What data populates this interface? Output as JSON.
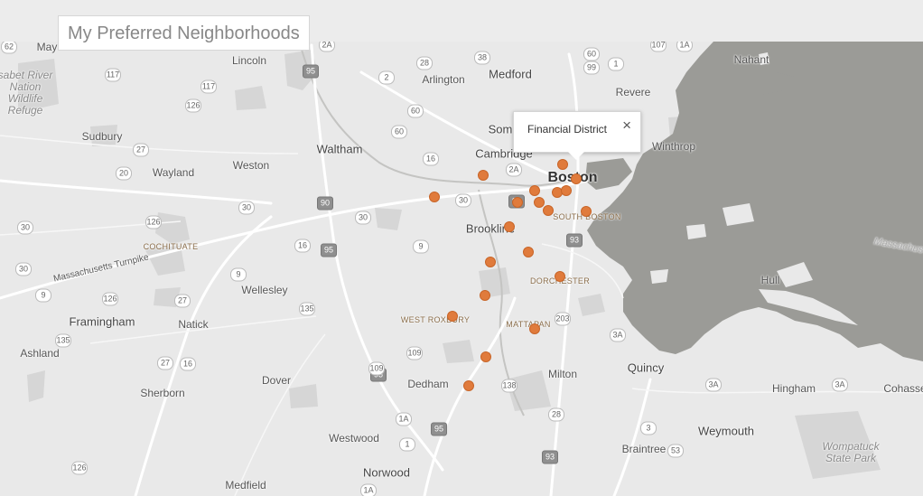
{
  "title": "My Preferred Neighborhoods",
  "popup": {
    "label": "Financial District",
    "close": "×"
  },
  "colors": {
    "marker": "#e07b3c",
    "water": "#9b9b97",
    "land": "#e9e9e9",
    "park": "#d7d7d7",
    "road": "#ffffff"
  },
  "labels": {
    "medford": "Medford",
    "arlington": "Arlington",
    "lincoln": "Lincoln",
    "nahant": "Nahant",
    "revere": "Revere",
    "winthrop": "Winthrop",
    "somerville": "Som",
    "cambridge": "Cambridge",
    "boston": "Boston",
    "south_boston": "SOUTH BOSTON",
    "brookline": "Brookline",
    "waltham": "Waltham",
    "weston": "Weston",
    "wayland": "Wayland",
    "sudbury": "Sudbury",
    "cochituate": "COCHITUATE",
    "wellesley": "Wellesley",
    "framingham": "Framingham",
    "natick": "Natick",
    "ashland": "Ashland",
    "dorchester": "DORCHESTER",
    "west_roxbury": "WEST ROXBURY",
    "mattapan": "MATTAPAN",
    "hull": "Hull",
    "quincy": "Quincy",
    "milton": "Milton",
    "dedham": "Dedham",
    "dover": "Dover",
    "sherborn": "Sherborn",
    "hingham": "Hingham",
    "cohasset": "Cohasse",
    "weymouth": "Weymouth",
    "braintree": "Braintree",
    "westwood": "Westwood",
    "norwood": "Norwood",
    "medfield": "Medfield",
    "may": "May",
    "refuge": "sabet River\nNation\nWildlife\nRefuge",
    "mass_pike": "Massachusetts Turnpike",
    "wompatuck": "Wompatuck\nState Park",
    "mass_bay": "Massachus"
  },
  "shields": [
    {
      "t": "62",
      "iw": false
    },
    {
      "t": "2A",
      "iw": false
    },
    {
      "t": "95",
      "iw": true
    },
    {
      "t": "2",
      "iw": false
    },
    {
      "t": "38",
      "iw": false
    },
    {
      "t": "28",
      "iw": false
    },
    {
      "t": "60",
      "iw": false
    },
    {
      "t": "99",
      "iw": false
    },
    {
      "t": "1",
      "iw": false
    },
    {
      "t": "107",
      "iw": false
    },
    {
      "t": "1A",
      "iw": false
    },
    {
      "t": "117",
      "iw": false
    },
    {
      "t": "117",
      "iw": false
    },
    {
      "t": "126",
      "iw": false
    },
    {
      "t": "60",
      "iw": false
    },
    {
      "t": "60",
      "iw": false
    },
    {
      "t": "27",
      "iw": false
    },
    {
      "t": "16",
      "iw": false
    },
    {
      "t": "20",
      "iw": false
    },
    {
      "t": "90",
      "iw": true
    },
    {
      "t": "30",
      "iw": false
    },
    {
      "t": "2A",
      "iw": false
    },
    {
      "t": "93",
      "iw": true
    },
    {
      "t": "126",
      "iw": false
    },
    {
      "t": "30",
      "iw": false
    },
    {
      "t": "30",
      "iw": false
    },
    {
      "t": "95",
      "iw": true
    },
    {
      "t": "16",
      "iw": false
    },
    {
      "t": "9",
      "iw": false
    },
    {
      "t": "93",
      "iw": true
    },
    {
      "t": "30",
      "iw": false
    },
    {
      "t": "9",
      "iw": false
    },
    {
      "t": "9",
      "iw": false
    },
    {
      "t": "126",
      "iw": false
    },
    {
      "t": "27",
      "iw": false
    },
    {
      "t": "135",
      "iw": false
    },
    {
      "t": "203",
      "iw": false
    },
    {
      "t": "3A",
      "iw": false
    },
    {
      "t": "135",
      "iw": false
    },
    {
      "t": "109",
      "iw": false
    },
    {
      "t": "27",
      "iw": false
    },
    {
      "t": "16",
      "iw": false
    },
    {
      "t": "95",
      "iw": true
    },
    {
      "t": "109",
      "iw": false
    },
    {
      "t": "138",
      "iw": false
    },
    {
      "t": "3A",
      "iw": false
    },
    {
      "t": "3A",
      "iw": false
    },
    {
      "t": "28",
      "iw": false
    },
    {
      "t": "1A",
      "iw": false
    },
    {
      "t": "95",
      "iw": true
    },
    {
      "t": "3",
      "iw": false
    },
    {
      "t": "1",
      "iw": false
    },
    {
      "t": "53",
      "iw": false
    },
    {
      "t": "93",
      "iw": true
    },
    {
      "t": "126",
      "iw": false
    },
    {
      "t": "1A",
      "iw": false
    },
    {
      "t": "30",
      "iw": false
    }
  ]
}
